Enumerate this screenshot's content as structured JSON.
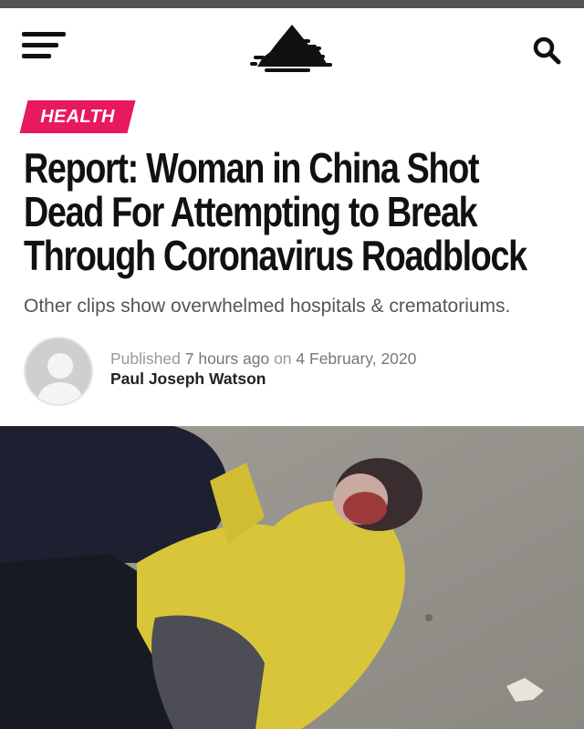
{
  "header": {
    "menu_icon": "hamburger-menu-icon",
    "logo_icon": "site-logo-mountain-icon",
    "search_icon": "search-icon"
  },
  "article": {
    "category": "HEALTH",
    "category_color": "#e8195e",
    "headline_lines": [
      "Report: Woman in China Shot",
      "Dead For Attempting to Break",
      "Through Coronavirus Roadblock"
    ],
    "subtitle": "Other clips show overwhelmed hospitals & crematoriums.",
    "byline": {
      "published_prefix": "Published",
      "relative_time": "7 hours ago",
      "on_word": "on",
      "date": "4 February, 2020",
      "author": "Paul Joseph Watson"
    },
    "hero_image": "video still: person in yellow coat lying on pavement"
  }
}
